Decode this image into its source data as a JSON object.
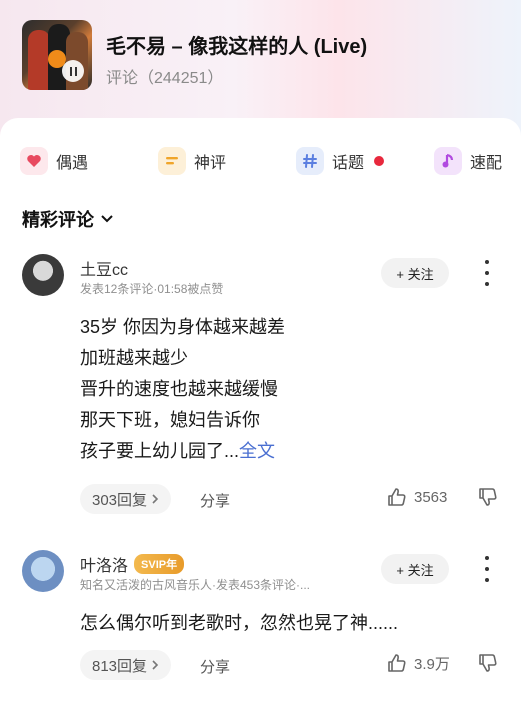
{
  "header": {
    "song_title": "毛不易 – 像我这样的人 (Live)",
    "comment_count_label": "评论（244251）"
  },
  "tabs": [
    {
      "label": "偶遇",
      "icon": "heart-icon",
      "color": "#e8495f"
    },
    {
      "label": "神评",
      "icon": "comment-lines-icon",
      "color": "#f0a52a"
    },
    {
      "label": "话题",
      "icon": "hash-icon",
      "color": "#5b7fe0",
      "has_red_dot": true
    },
    {
      "label": "速配",
      "icon": "music-note-icon",
      "color": "#b14be0"
    }
  ],
  "section": {
    "title": "精彩评论"
  },
  "comments": [
    {
      "username": "土豆cc",
      "meta": "发表12条评论·01:58被点赞",
      "follow_label": "+ 关注",
      "lines": [
        "35岁 你因为身体越来越差",
        "加班越来越少",
        "晋升的速度也越来越缓慢",
        "那天下班，媳妇告诉你"
      ],
      "last_line": "孩子要上幼儿园了...",
      "fulltext_label": "全文",
      "replies_label": "303回复",
      "share_label": "分享",
      "likes": "3563"
    },
    {
      "username": "叶洛洛",
      "badge": "SVIP年",
      "meta": "知名又活泼的古风音乐人·发表453条评论·...",
      "follow_label": "+ 关注",
      "lines": [
        "怎么偶尔听到老歌时，忽然也晃了神......"
      ],
      "replies_label": "813回复",
      "share_label": "分享",
      "likes": "3.9万"
    }
  ],
  "colors": {
    "accent_link": "#4a6fd1",
    "red_dot": "#e8283d",
    "svip_gold": "#efb040"
  }
}
